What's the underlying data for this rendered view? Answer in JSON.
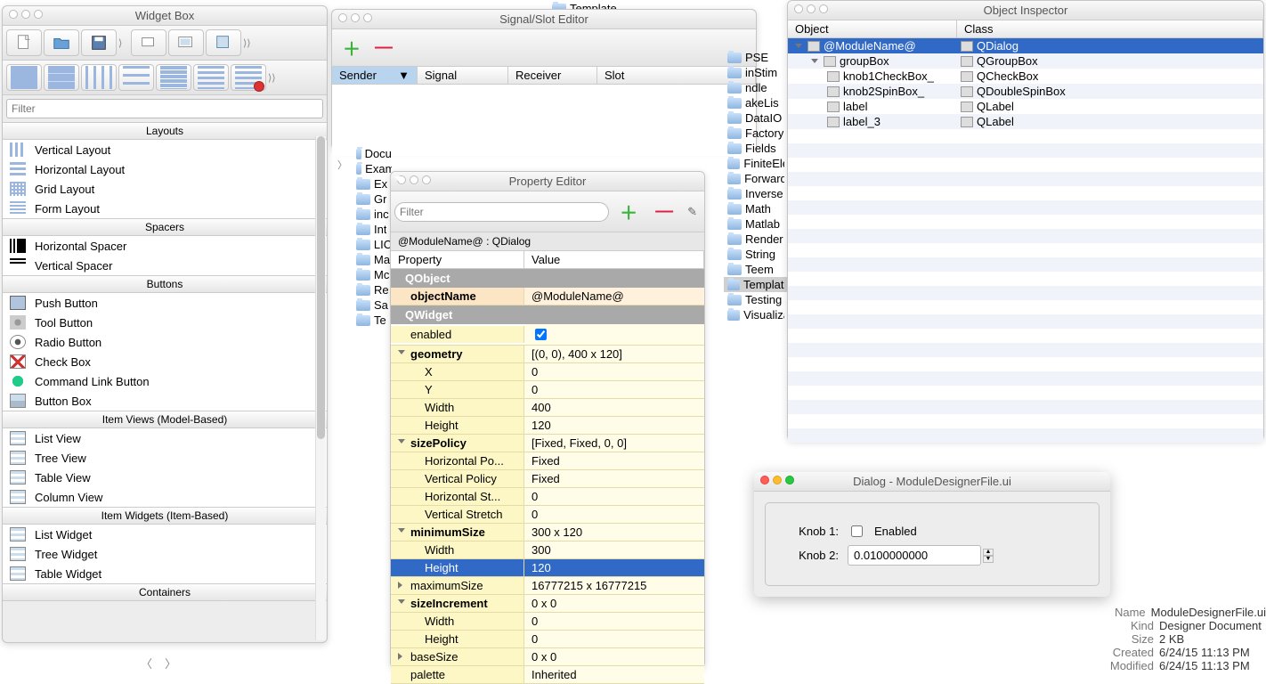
{
  "template_label": "Template",
  "widgetBox": {
    "title": "Widget Box",
    "filter_placeholder": "Filter",
    "sections": {
      "layouts": {
        "header": "Layouts",
        "items": [
          "Vertical Layout",
          "Horizontal Layout",
          "Grid Layout",
          "Form Layout"
        ]
      },
      "spacers": {
        "header": "Spacers",
        "items": [
          "Horizontal Spacer",
          "Vertical Spacer"
        ]
      },
      "buttons": {
        "header": "Buttons",
        "items": [
          "Push Button",
          "Tool Button",
          "Radio Button",
          "Check Box",
          "Command Link Button",
          "Button Box"
        ]
      },
      "itemViews": {
        "header": "Item Views (Model-Based)",
        "items": [
          "List View",
          "Tree View",
          "Table View",
          "Column View"
        ]
      },
      "itemWidgets": {
        "header": "Item Widgets (Item-Based)",
        "items": [
          "List Widget",
          "Tree Widget",
          "Table Widget"
        ]
      },
      "containers": {
        "header": "Containers"
      }
    }
  },
  "signalSlot": {
    "title": "Signal/Slot Editor",
    "cols": {
      "sender": "Sender",
      "signal": "Signal",
      "receiver": "Receiver",
      "slot": "Slot"
    }
  },
  "folders_left": [
    "Documentation",
    "ExampleNets",
    "Ex",
    "Gr",
    "inc",
    "Int",
    "LIC",
    "Ma",
    "Mc",
    "Re",
    "Sa",
    "Te"
  ],
  "folders_right": [
    "PSE",
    "inStim",
    "ndle",
    "akeLis",
    "DataIO",
    "Factory",
    "Fields",
    "FiniteEle",
    "Forward",
    "Inverse",
    "Math",
    "Matlab",
    "Render",
    "String",
    "Teem",
    "Template",
    "Testing",
    "Visualiza"
  ],
  "propertyEditor": {
    "title": "Property Editor",
    "filter_placeholder": "Filter",
    "crumb": "@ModuleName@ : QDialog",
    "cols": {
      "prop": "Property",
      "val": "Value"
    },
    "groups": {
      "qobject": "QObject",
      "qwidget": "QWidget"
    },
    "rows": {
      "objectName": {
        "k": "objectName",
        "v": "@ModuleName@"
      },
      "enabled": {
        "k": "enabled",
        "v": true
      },
      "geometry": {
        "k": "geometry",
        "v": "[(0, 0), 400 x 120]"
      },
      "X": {
        "k": "X",
        "v": "0"
      },
      "Y": {
        "k": "Y",
        "v": "0"
      },
      "Width": {
        "k": "Width",
        "v": "400"
      },
      "Height": {
        "k": "Height",
        "v": "120"
      },
      "sizePolicy": {
        "k": "sizePolicy",
        "v": "[Fixed, Fixed, 0, 0]"
      },
      "hPol": {
        "k": "Horizontal Po...",
        "v": "Fixed"
      },
      "vPol": {
        "k": "Vertical Policy",
        "v": "Fixed"
      },
      "hSt": {
        "k": "Horizontal St...",
        "v": "0"
      },
      "vSt": {
        "k": "Vertical Stretch",
        "v": "0"
      },
      "minSize": {
        "k": "minimumSize",
        "v": "300 x 120"
      },
      "minW": {
        "k": "Width",
        "v": "300"
      },
      "minH": {
        "k": "Height",
        "v": "120"
      },
      "maxSize": {
        "k": "maximumSize",
        "v": "16777215 x 16777215"
      },
      "sizeInc": {
        "k": "sizeIncrement",
        "v": "0 x 0"
      },
      "siW": {
        "k": "Width",
        "v": "0"
      },
      "siH": {
        "k": "Height",
        "v": "0"
      },
      "baseSize": {
        "k": "baseSize",
        "v": "0 x 0"
      },
      "palette": {
        "k": "palette",
        "v": "Inherited"
      }
    }
  },
  "objectInspector": {
    "title": "Object Inspector",
    "cols": {
      "obj": "Object",
      "cls": "Class"
    },
    "rows": [
      {
        "obj": "@ModuleName@",
        "cls": "QDialog",
        "depth": 0,
        "sel": true
      },
      {
        "obj": "groupBox",
        "cls": "QGroupBox",
        "depth": 1
      },
      {
        "obj": "knob1CheckBox_",
        "cls": "QCheckBox",
        "depth": 2
      },
      {
        "obj": "knob2SpinBox_",
        "cls": "QDoubleSpinBox",
        "depth": 2
      },
      {
        "obj": "label",
        "cls": "QLabel",
        "depth": 2
      },
      {
        "obj": "label_3",
        "cls": "QLabel",
        "depth": 2
      }
    ]
  },
  "dialog": {
    "title": "Dialog - ModuleDesignerFile.ui",
    "knob1_label": "Knob 1:",
    "knob1_check": "Enabled",
    "knob2_label": "Knob 2:",
    "knob2_value": "0.0100000000"
  },
  "fileInfo": {
    "Name": "ModuleDesignerFile.ui",
    "Kind": "Designer Document",
    "Size": "2 KB",
    "Created": "6/24/15 11:13 PM",
    "Modified": "6/24/15 11:13 PM"
  }
}
